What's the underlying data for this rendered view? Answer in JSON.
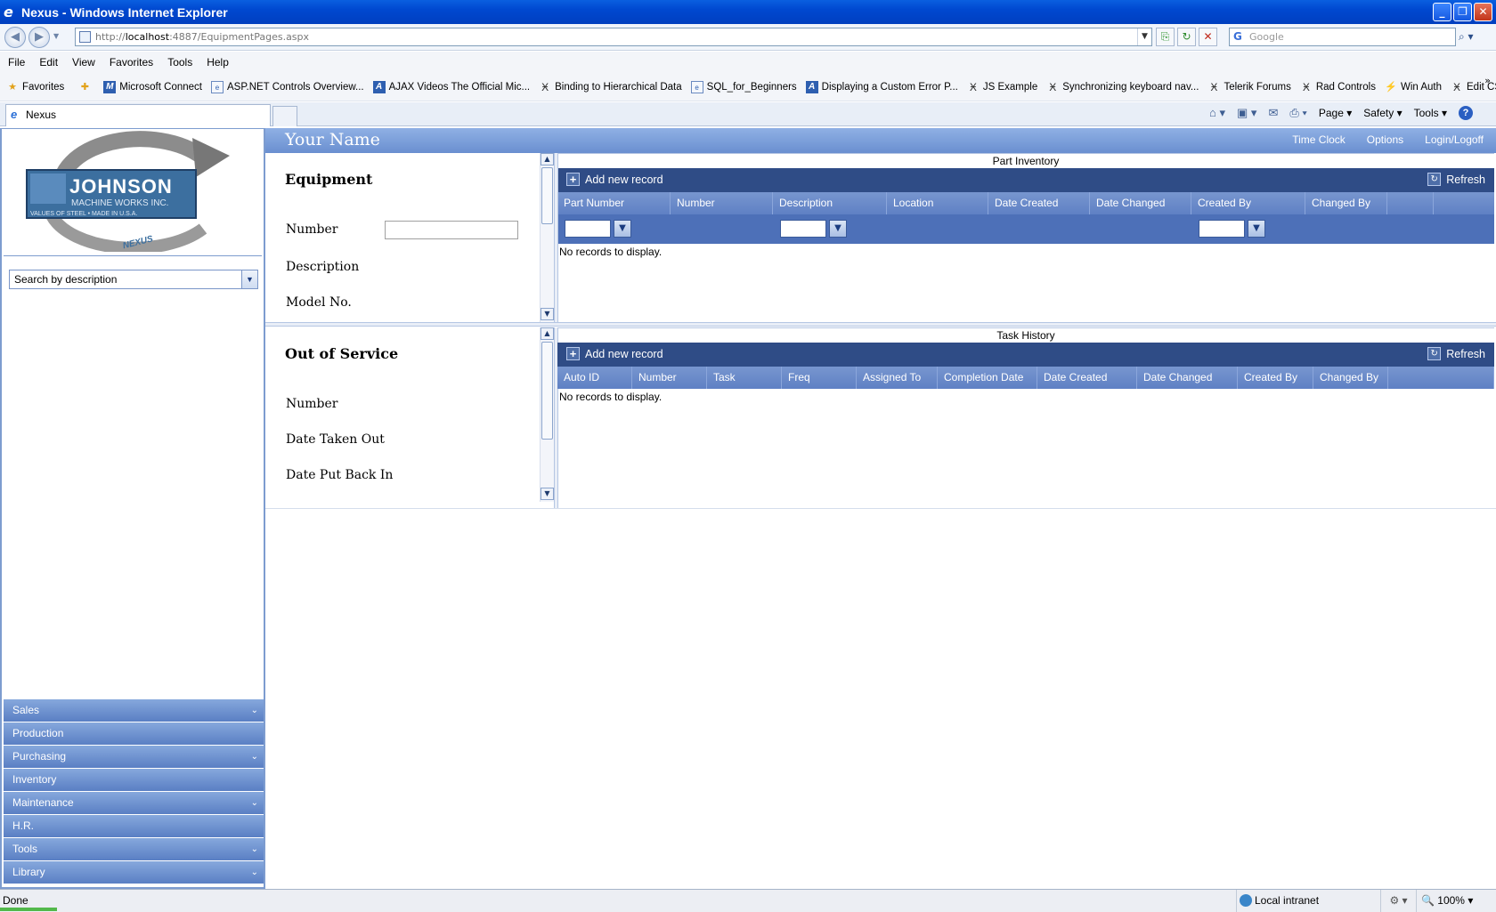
{
  "window": {
    "title": "Nexus - Windows Internet Explorer"
  },
  "address": {
    "prefix": "http://",
    "host": "localhost",
    "rest": ":4887/EquipmentPages.aspx",
    "search_placeholder": "Google"
  },
  "menu": [
    "File",
    "Edit",
    "View",
    "Favorites",
    "Tools",
    "Help"
  ],
  "favorites": {
    "label": "Favorites",
    "items": [
      {
        "label": "Microsoft Connect",
        "icon": "msdn-icon"
      },
      {
        "label": "ASP.NET Controls Overview...",
        "icon": "page-icon"
      },
      {
        "label": "AJAX Videos The Official Mic...",
        "icon": "aspnet-icon"
      },
      {
        "label": "Binding to Hierarchical Data",
        "icon": "telerik-icon"
      },
      {
        "label": "SQL_for_Beginners",
        "icon": "page-icon"
      },
      {
        "label": "Displaying a Custom Error P...",
        "icon": "aspnet-icon"
      },
      {
        "label": "JS Example",
        "icon": "telerik-icon"
      },
      {
        "label": "Synchronizing keyboard nav...",
        "icon": "telerik-icon"
      },
      {
        "label": "Telerik Forums",
        "icon": "telerik-icon"
      },
      {
        "label": "Rad Controls",
        "icon": "telerik-icon"
      },
      {
        "label": "Win Auth",
        "icon": "wand-icon"
      },
      {
        "label": "Edit CSS",
        "icon": "telerik-icon"
      }
    ]
  },
  "tab": {
    "label": "Nexus"
  },
  "commandbar": {
    "page": "Page",
    "safety": "Safety",
    "tools": "Tools"
  },
  "sidebar": {
    "logo": {
      "name": "JOHNSON",
      "line2": "MACHINE WORKS INC.",
      "line3": "VALUES OF STEEL • MADE IN U.S.A.",
      "nexus": "NEXUS"
    },
    "search_value": "Search by description",
    "panel": [
      {
        "label": "Sales",
        "expandable": true
      },
      {
        "label": "Production",
        "expandable": false
      },
      {
        "label": "Purchasing",
        "expandable": true
      },
      {
        "label": "Inventory",
        "expandable": false
      },
      {
        "label": "Maintenance",
        "expandable": true
      },
      {
        "label": "H.R.",
        "expandable": false
      },
      {
        "label": "Tools",
        "expandable": true
      },
      {
        "label": "Library",
        "expandable": true
      }
    ]
  },
  "header": {
    "user": "Your Name",
    "links": [
      "Time Clock",
      "Options",
      "Login/Logoff"
    ]
  },
  "equipment": {
    "title": "Equipment",
    "number_label": "Number",
    "description_label": "Description",
    "model_label": "Model No."
  },
  "out_of_service": {
    "title": "Out of Service",
    "number_label": "Number",
    "taken_out_label": "Date Taken Out",
    "put_back_label": "Date Put Back In"
  },
  "part_inventory": {
    "caption": "Part Inventory",
    "add_label": "Add new record",
    "refresh_label": "Refresh",
    "columns": [
      "Part Number",
      "Number",
      "Description",
      "Location",
      "Date Created",
      "Date Changed",
      "Created By",
      "Changed By",
      ""
    ],
    "empty": "No records to display."
  },
  "task_history": {
    "caption": "Task History",
    "add_label": "Add new record",
    "refresh_label": "Refresh",
    "columns": [
      "Auto ID",
      "Number",
      "Task",
      "Freq",
      "Assigned To",
      "Completion Date",
      "Date Created",
      "Date Changed",
      "Created By",
      "Changed By",
      ""
    ],
    "empty": "No records to display."
  },
  "status": {
    "text": "Done",
    "zone": "Local intranet",
    "zoom": "100%"
  }
}
